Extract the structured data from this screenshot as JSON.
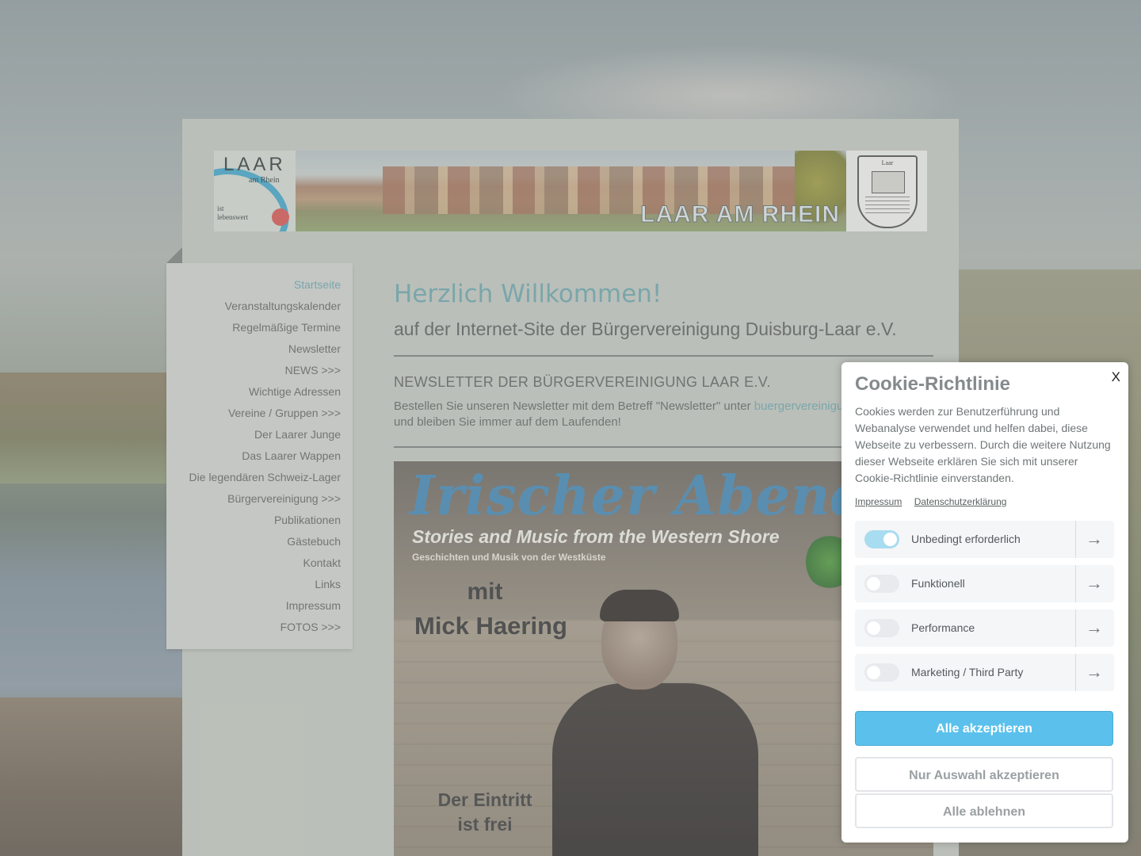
{
  "banner": {
    "logo_title": "LAAR",
    "logo_subtitle": "am Rhein",
    "logo_tagline": "ist lebenswert",
    "banner_text": "LAAR AM RHEIN",
    "crest_label": "Laar"
  },
  "sidebar": {
    "items": [
      {
        "label": "Startseite",
        "active": true
      },
      {
        "label": "Veranstaltungskalender"
      },
      {
        "label": "Regelmäßige Termine"
      },
      {
        "label": "Newsletter"
      },
      {
        "label": "NEWS >>>"
      },
      {
        "label": "Wichtige Adressen"
      },
      {
        "label": "Vereine / Gruppen >>>"
      },
      {
        "label": "Der Laarer Junge"
      },
      {
        "label": "Das Laarer Wappen"
      },
      {
        "label": "Die legendären Schweiz-Lager"
      },
      {
        "label": "Bürgervereinigung >>>"
      },
      {
        "label": "Publikationen"
      },
      {
        "label": "Gästebuch"
      },
      {
        "label": "Kontakt"
      },
      {
        "label": "Links"
      },
      {
        "label": "Impressum"
      },
      {
        "label": "FOTOS >>>"
      }
    ]
  },
  "content": {
    "welcome": "Herzlich Willkommen!",
    "subtitle": "auf der Internet-Site der Bürgervereinigung Duisburg-Laar e.V.",
    "news_heading": "NEWSLETTER DER BÜRGERVEREINIGUNG LAAR E.V.",
    "news_text_before": "Bestellen Sie unseren Newsletter mit dem Betreff \"Newsletter\" unter ",
    "news_link": "buergervereinigu",
    "news_text_after": "und bleiben Sie immer auf dem Laufenden!"
  },
  "poster": {
    "title": "Irischer Abend",
    "subtitle": "Stories and Music from the Western Shore",
    "subtitle_de": "Geschichten und Musik von der Westküste",
    "mit": "mit",
    "name": "Mick Haering",
    "entry_line1": "Der Eintritt",
    "entry_line2": "ist frei"
  },
  "cookie": {
    "close": "X",
    "title": "Cookie-Richtlinie",
    "description": "Cookies werden zur Benutzerführung und Webanalyse verwendet und helfen dabei, diese Webseite zu verbessern. Durch die weitere Nutzung dieser Webseite erklären Sie sich mit unserer Cookie-Richtlinie einverstanden.",
    "link_impressum": "Impressum",
    "link_datenschutz": "Datenschutzerklärung",
    "categories": [
      {
        "label": "Unbedingt erforderlich",
        "enabled": true
      },
      {
        "label": "Funktionell",
        "enabled": false
      },
      {
        "label": "Performance",
        "enabled": false
      },
      {
        "label": "Marketing / Third Party",
        "enabled": false
      }
    ],
    "btn_accept_all": "Alle akzeptieren",
    "btn_accept_selection": "Nur Auswahl akzeptieren",
    "btn_decline_all": "Alle ablehnen"
  },
  "colors": {
    "accent": "#6aa7ad",
    "primary_button": "#5bc1ec"
  }
}
